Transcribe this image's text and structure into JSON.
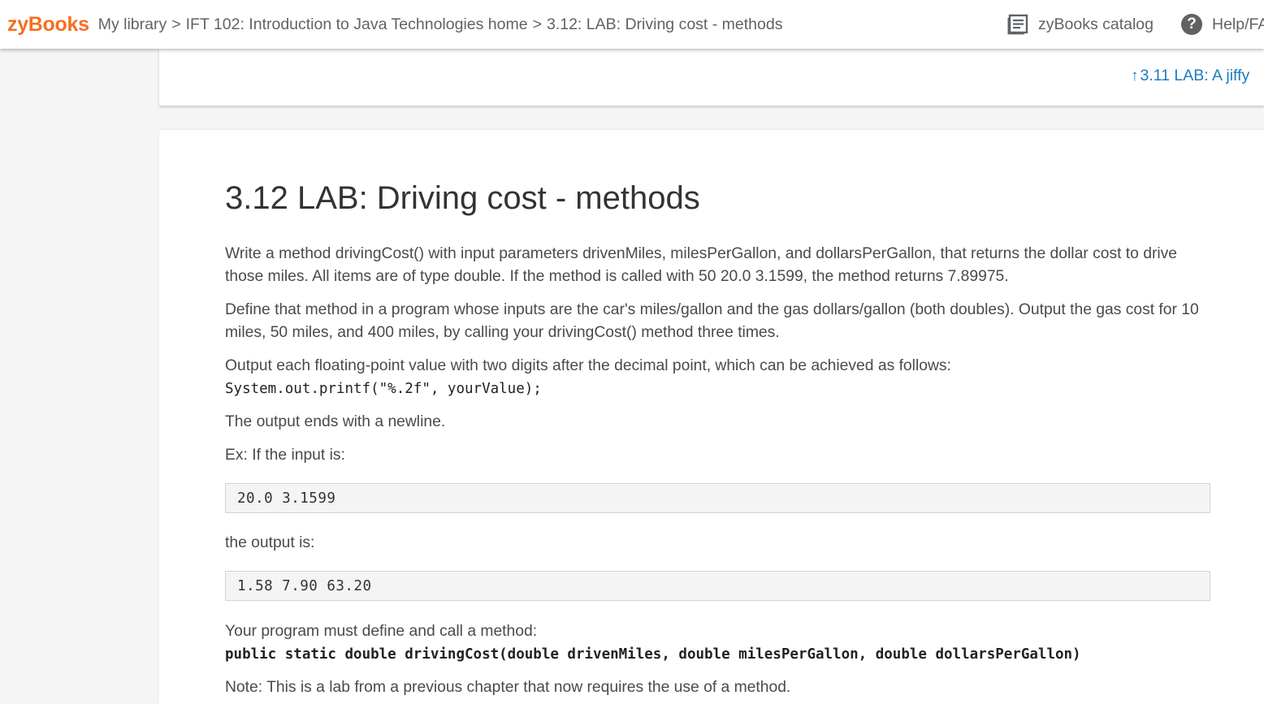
{
  "topbar": {
    "logo": "zyBooks",
    "breadcrumb": [
      "My library",
      "IFT 102: Introduction to Java Technologies home",
      "3.12: LAB: Driving cost - methods"
    ],
    "separator": ">",
    "catalog_label": "zyBooks catalog",
    "help_icon_glyph": "?",
    "help_label": "Help/FAQ"
  },
  "nav": {
    "prev_arrow": "↑",
    "prev_label": "3.11 LAB: A jiffy"
  },
  "section": {
    "title": "3.12 LAB: Driving cost - methods",
    "p1": "Write a method drivingCost() with input parameters drivenMiles, milesPerGallon, and dollarsPerGallon, that returns the dollar cost to drive those miles. All items are of type double. If the method is called with 50 20.0 3.1599, the method returns 7.89975.",
    "p2": "Define that method in a program whose inputs are the car's miles/gallon and the gas dollars/gallon (both doubles). Output the gas cost for 10 miles, 50 miles, and 400 miles, by calling your drivingCost() method three times.",
    "p3": "Output each floating-point value with two digits after the decimal point, which can be achieved as follows:",
    "p3_code": "System.out.printf(\"%.2f\", yourValue);",
    "p4": "The output ends with a newline.",
    "p5": "Ex: If the input is:",
    "example_input": "20.0 3.1599",
    "p6": "the output is:",
    "example_output": "1.58 7.90 63.20",
    "p7": "Your program must define and call a method:",
    "p7_code": "public static double drivingCost(double drivenMiles, double milesPerGallon, double dollarsPerGallon)",
    "p8": "Note: This is a lab from a previous chapter that now requires the use of a method."
  },
  "colors": {
    "brand": "#f37021",
    "link": "#1a7bc0"
  }
}
